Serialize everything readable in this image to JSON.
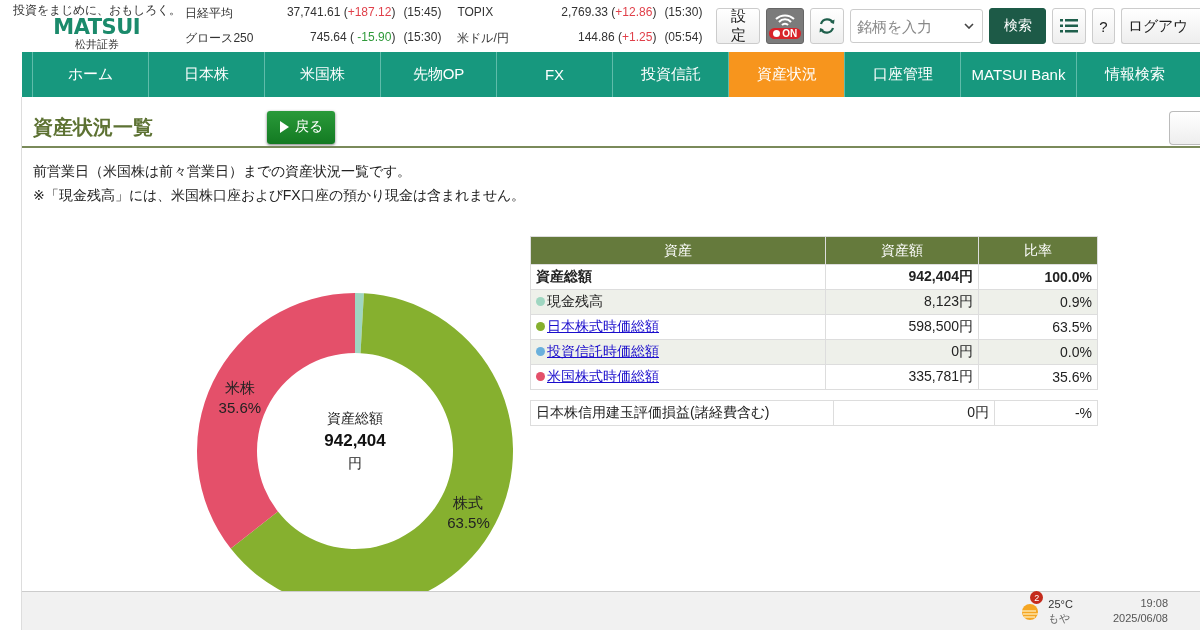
{
  "logo": {
    "tagline": "投資をまじめに、おもしろく。",
    "name": "MATSUI",
    "subtitle": "松井証券"
  },
  "tickers": [
    {
      "name": "日経平均",
      "value": "37,741.61",
      "open": "(",
      "change": "+187.12",
      "close": ")",
      "color": "#e0404a",
      "time": "(15:45)"
    },
    {
      "name": "TOPIX",
      "value": "2,769.33",
      "open": "(",
      "change": "+12.86",
      "close": ")",
      "color": "#e0404a",
      "time": "(15:30)"
    },
    {
      "name": "グロース250",
      "value": "745.64",
      "open": "( ",
      "change": "-15.90",
      "close": ")",
      "color": "#2f9a3a",
      "time": "(15:30)"
    },
    {
      "name": "米ドル/円",
      "value": "144.86",
      "open": "(",
      "change": "+1.25",
      "close": ")",
      "color": "#e0404a",
      "time": "(05:54)"
    }
  ],
  "toolbar": {
    "settings": "設定",
    "wifi_toggle": {
      "label": "ON",
      "on": true
    },
    "search": {
      "placeholder": "銘柄を入力"
    },
    "search_button": "検索",
    "help": "?",
    "logout": "ログアウ"
  },
  "nav": [
    {
      "label": "ホーム",
      "selected": false
    },
    {
      "label": "日本株",
      "selected": false
    },
    {
      "label": "米国株",
      "selected": false
    },
    {
      "label": "先物OP",
      "selected": false
    },
    {
      "label": "FX",
      "selected": false
    },
    {
      "label": "投資信託",
      "selected": false
    },
    {
      "label": "資産状況",
      "selected": true
    },
    {
      "label": "口座管理",
      "selected": false
    },
    {
      "label": "MATSUI Bank",
      "selected": false
    },
    {
      "label": "情報検索",
      "selected": false
    }
  ],
  "page": {
    "title": "資産状況一覧",
    "back_button": "戻る",
    "notes": [
      "前営業日（米国株は前々営業日）までの資産状況一覧です。",
      "※「現金残高」には、米国株口座およびFX口座の預かり現金は含まれません。"
    ]
  },
  "chart": {
    "center": {
      "label": "資産総額",
      "amount": "942,404",
      "unit": "円"
    },
    "chart_data": {
      "type": "donut",
      "categories": [
        null,
        "株式",
        "米株"
      ],
      "values": [
        0.9,
        63.5,
        35.6
      ],
      "colors": [
        "#9fd6c1",
        "#86b02f",
        "#e4506a"
      ],
      "value_labels": [
        null,
        "63.5%",
        "35.6%"
      ]
    }
  },
  "table": {
    "columns": [
      "資産",
      "資産額",
      "比率"
    ],
    "total": {
      "label": "資産総額",
      "amount": "942,404円",
      "ratio": "100.0%"
    },
    "rows": [
      {
        "label": "現金残高",
        "link": false,
        "color": "#9fd6c1",
        "amount": "8,123円",
        "ratio": "0.9%"
      },
      {
        "label": "日本株式時価総額",
        "link": true,
        "color": "#86b02f",
        "amount": "598,500円",
        "ratio": "63.5%"
      },
      {
        "label": "投資信託時価総額",
        "link": true,
        "color": "#6ab0dc",
        "amount": "0円",
        "ratio": "0.0%"
      },
      {
        "label": "米国株式時価総額",
        "link": true,
        "color": "#e4506a",
        "amount": "335,781円",
        "ratio": "35.6%"
      }
    ],
    "extra": {
      "label": "日本株信用建玉評価損益(諸経費含む)",
      "amount": "0円",
      "ratio": "-%"
    }
  },
  "taskbar": {
    "notification_count": "2",
    "temperature": "25°C",
    "weather": "もや",
    "time": "19:08",
    "date": "2025/06/08"
  }
}
